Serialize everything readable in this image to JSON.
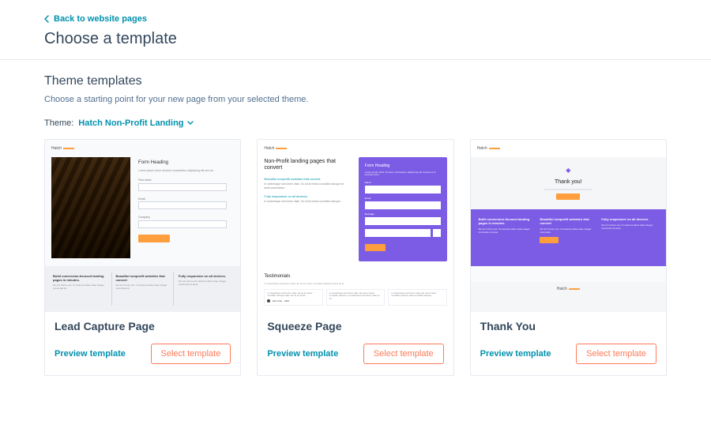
{
  "header": {
    "back_label": "Back to website pages",
    "title": "Choose a template"
  },
  "section": {
    "title": "Theme templates",
    "subtitle": "Choose a starting point for your new page from your selected theme."
  },
  "theme": {
    "label": "Theme:",
    "value": "Hatch Non-Profit Landing"
  },
  "actions": {
    "preview": "Preview template",
    "select": "Select template"
  },
  "templates": [
    {
      "name": "Lead Capture Page"
    },
    {
      "name": "Squeeze Page"
    },
    {
      "name": "Thank You"
    }
  ],
  "thumbs": {
    "brand": "Hatch",
    "t1": {
      "form_heading": "Form Heading",
      "form_sub": "Lorem ipsum dolor sit amet consectetur adipiscing elit sed do.",
      "labels": [
        "First name",
        "Email",
        "Company"
      ],
      "strip": [
        {
          "h": "Build conversion-focused landing pages in minutes.",
          "p": "Sit orci rutrum est. Ut vivamus tellus vitae integer commodo sit."
        },
        {
          "h": "Beautiful nonprofit websites that convert",
          "p": "Sit orci rutrum est. Ut vivamus tellus vitae integer commodo sit."
        },
        {
          "h": "Fully responsive on all devices.",
          "p": "Sit orci rutrum est vivamus tellus vitae integer commodo sit amet."
        }
      ]
    },
    "t2": {
      "headline": "Non-Profit landing pages that convert",
      "blue1": "Beautiful nonprofit websites that convert.",
      "grey1": "In scelerisque sed lorem vitae. Eu sit at metus convallis natoque sit amet consectetur.",
      "blue2": "Fully responsive on all devices.",
      "grey2": "In scelerisque sed lorem vitae. Eu sit at metus convallis natoque.",
      "panel_heading": "Form Heading",
      "panel_text": "Lorem ipsum dolor sit amet, consectetur adipiscing elit. Fames id ut pulvinar enim.",
      "testimonials_h": "Testimonials",
      "testimonials_s": "In scelerisque sed lorem vitae. Eu sit at metus convallis natoque lectus sit et.",
      "author": "John Doe · CEO"
    },
    "t3": {
      "thank_you": "Thank you!",
      "band": [
        {
          "h": "Build conversion-focused landing pages in minutes.",
          "p": "Sit orci rutrum est. Ut vivamus tellus vitae integer commodo sit amet."
        },
        {
          "h": "Beautiful nonprofit websites that convert",
          "p": "Sit orci rutrum est. Ut vivamus tellus vitae integer commodo.",
          "btn": true
        },
        {
          "h": "Fully responsive on all devices.",
          "p": "Sit orci rutrum est. Ut vivamus tellus vitae integer commodo sit amet."
        }
      ]
    }
  }
}
